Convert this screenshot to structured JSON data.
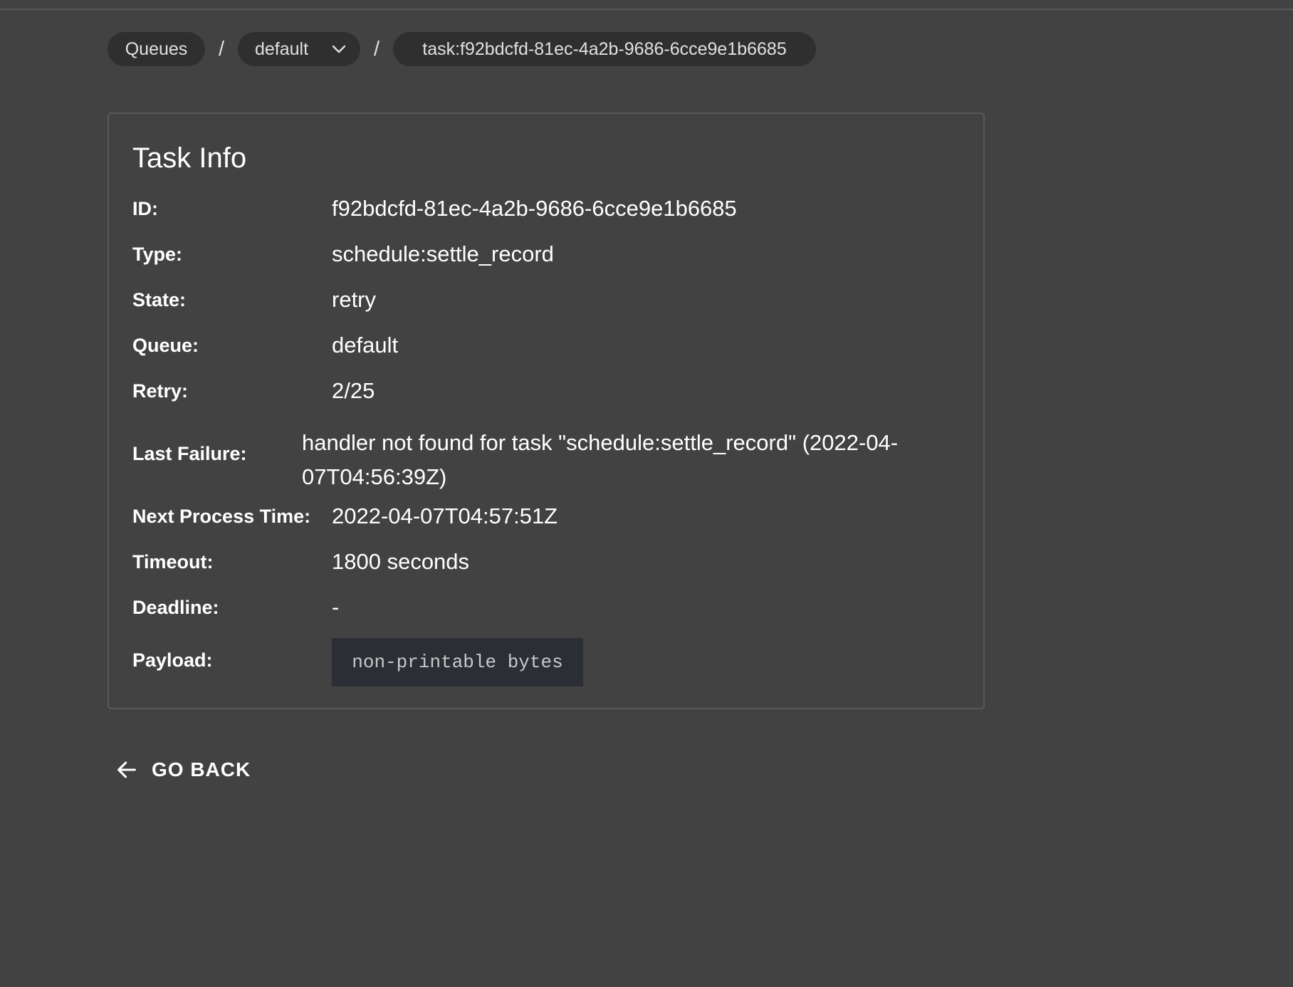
{
  "breadcrumb": {
    "queues_label": "Queues",
    "separator": "/",
    "queue_label": "default",
    "task_label": "task:f92bdcfd-81ec-4a2b-9686-6cce9e1b6685"
  },
  "task_info": {
    "title": "Task Info",
    "fields": [
      {
        "label": "ID:",
        "value": "f92bdcfd-81ec-4a2b-9686-6cce9e1b6685"
      },
      {
        "label": "Type:",
        "value": "schedule:settle_record"
      },
      {
        "label": "State:",
        "value": "retry"
      },
      {
        "label": "Queue:",
        "value": "default"
      },
      {
        "label": "Retry:",
        "value": "2/25"
      },
      {
        "label": "Last Failure:",
        "value": "handler not found for task \"schedule:settle_record\" (2022-04-07T04:56:39Z)"
      },
      {
        "label": "Next Process Time:",
        "value": "2022-04-07T04:57:51Z"
      },
      {
        "label": "Timeout:",
        "value": "1800 seconds"
      },
      {
        "label": "Deadline:",
        "value": "-"
      },
      {
        "label": "Payload:",
        "value": "non-printable bytes"
      }
    ]
  },
  "go_back": {
    "label": "GO BACK",
    "icon": "arrow-left-icon"
  },
  "icons": {
    "queue_dropdown": "chevron-down-icon"
  },
  "colors": {
    "background": "#424242",
    "chip_background": "#2f2f2f",
    "card_border": "#595959",
    "payload_background": "#2c2e35"
  }
}
